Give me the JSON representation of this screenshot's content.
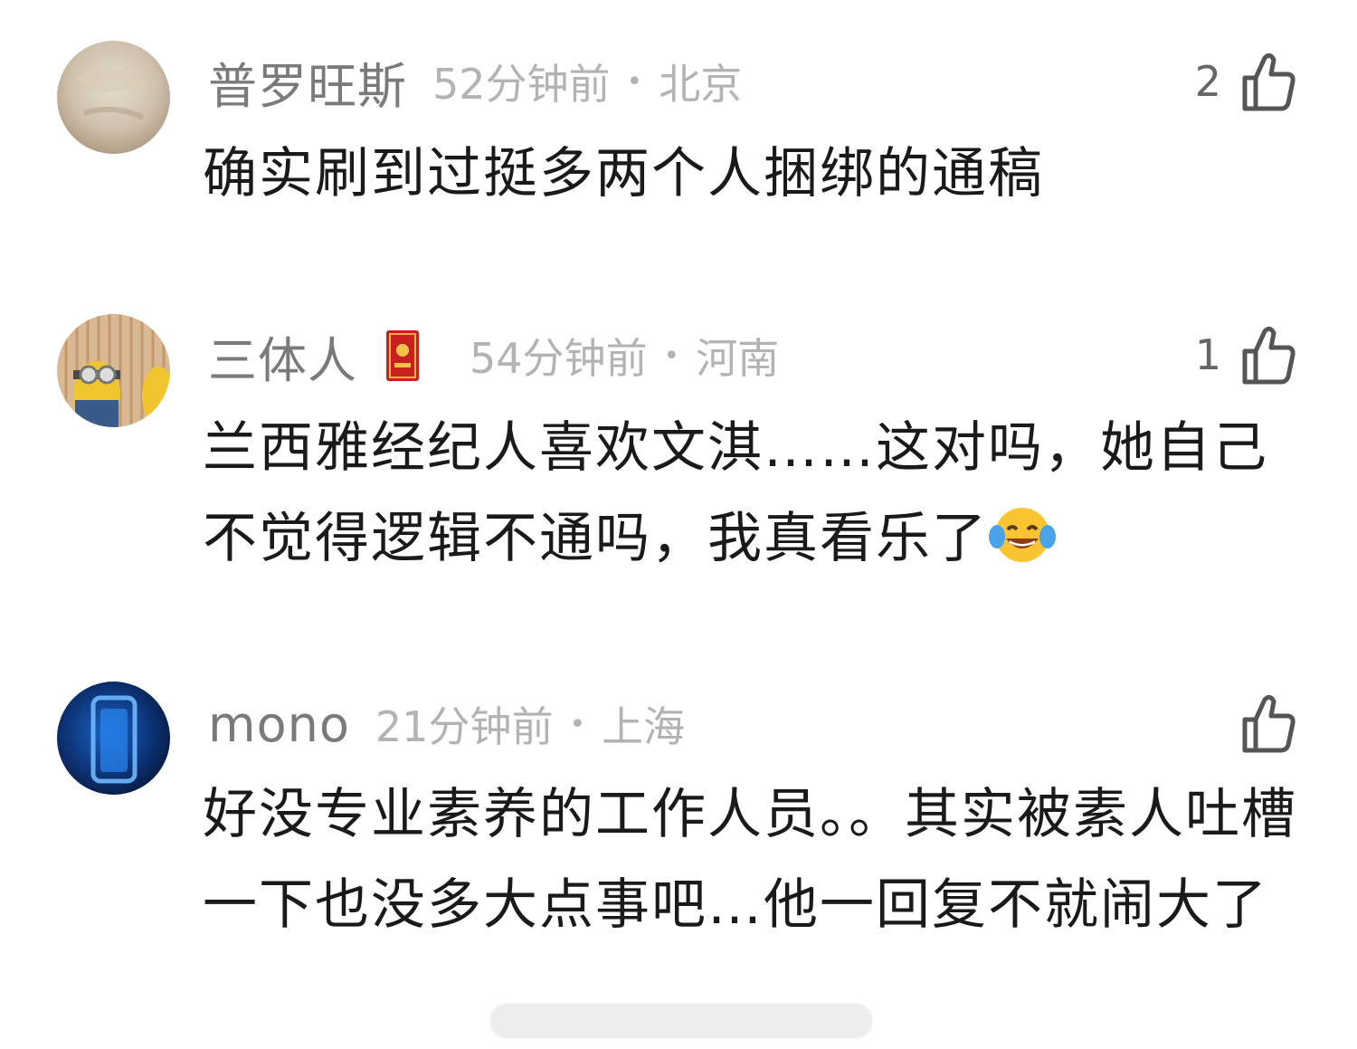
{
  "comments": [
    {
      "username": "普罗旺斯",
      "time": "52分钟前",
      "separator": "•",
      "location": "北京",
      "likes": "2",
      "text": "确实刷到过挺多两个人捆绑的通稿"
    },
    {
      "username": "三体人",
      "time": "54分钟前",
      "separator": "•",
      "location": "河南",
      "likes": "1",
      "text": "兰西雅经纪人喜欢文淇……这对吗，她自己不觉得逻辑不通吗，我真看乐了",
      "emoji": "laughing-tears-emoji"
    },
    {
      "username": "mono",
      "time": "21分钟前",
      "separator": "•",
      "location": "上海",
      "likes": "",
      "text": "好没专业素养的工作人员。。其实被素人吐槽一下也没多大点事吧…他一回复不就闹大了"
    }
  ],
  "icons": {
    "like": "thumbs-up-icon",
    "badge": "red-card-badge-icon"
  }
}
